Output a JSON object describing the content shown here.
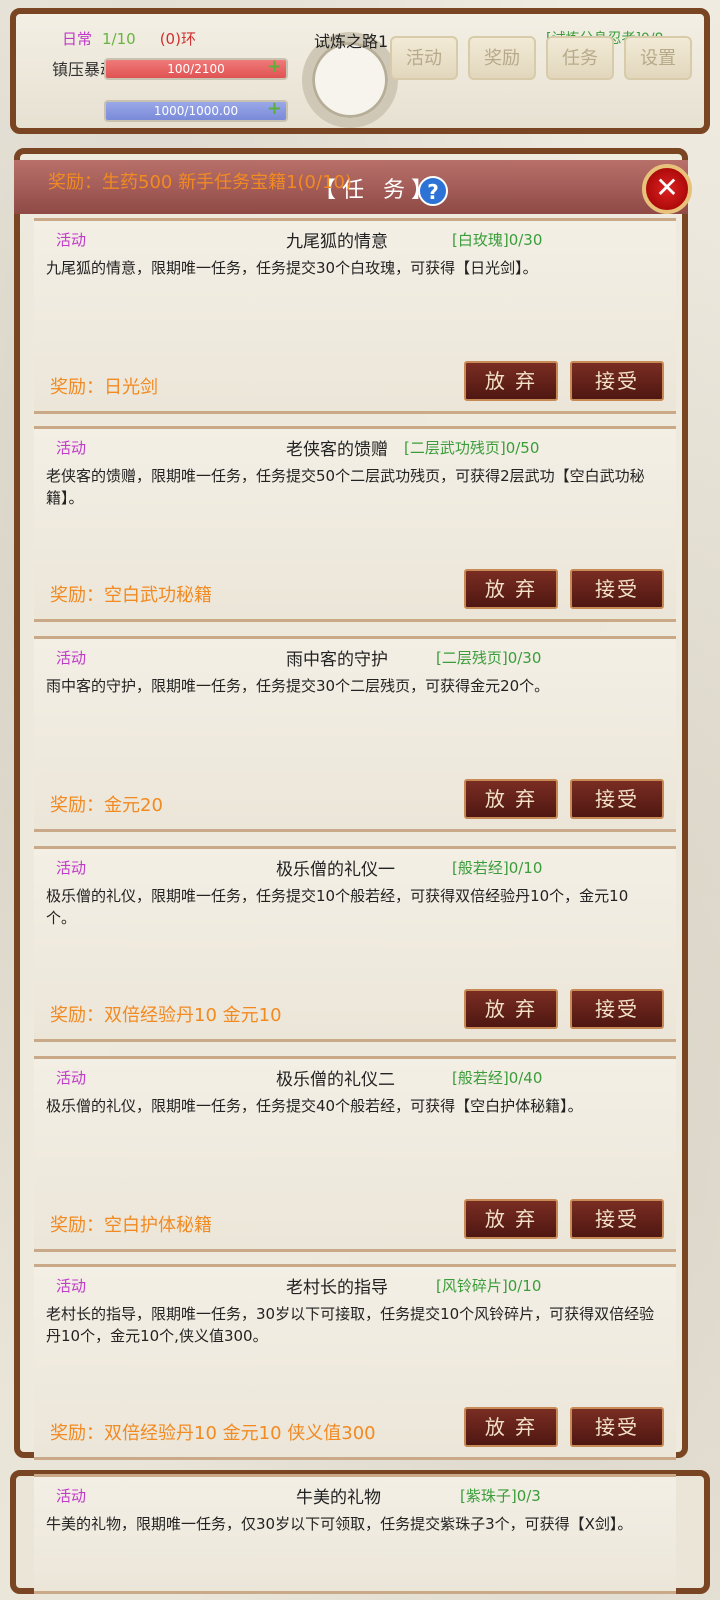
{
  "hud": {
    "daily_label": "日常",
    "daily_count": "1/10",
    "ring": "(0)环",
    "monster_task": "镇压暴动的怪物",
    "hp_text": "100/2100",
    "mp_text": "1000/1000.00",
    "trial_title": "试炼之路1",
    "clone_status": "[试炼分身忍者]0/8",
    "tabs": [
      "活动",
      "奖励",
      "任务",
      "设置"
    ]
  },
  "panel": {
    "title": "【任 务】",
    "help": "?",
    "close": "✕",
    "top_reward": "奖励：生药500 新手任务宝籍1(0/10)",
    "abandon_label": "放 弃",
    "accept_label": "接受"
  },
  "quests": [
    {
      "tag": "活动",
      "name": "九尾狐的情意",
      "req": "[白玫瑰]0/30",
      "desc": "九尾狐的情意，限期唯一任务，任务提交30个白玫瑰，可获得【日光剑】。",
      "reward": "奖励：日光剑"
    },
    {
      "tag": "活动",
      "name": "老侠客的馈赠",
      "req": "[二层武功残页]0/50",
      "desc": "老侠客的馈赠，限期唯一任务，任务提交50个二层武功残页，可获得2层武功【空白武功秘籍】。",
      "reward": "奖励：空白武功秘籍"
    },
    {
      "tag": "活动",
      "name": "雨中客的守护",
      "req": "[二层残页]0/30",
      "desc": "雨中客的守护，限期唯一任务，任务提交30个二层残页，可获得金元20个。",
      "reward": "奖励：金元20"
    },
    {
      "tag": "活动",
      "name": "极乐僧的礼仪一",
      "req": "[般若经]0/10",
      "desc": "极乐僧的礼仪，限期唯一任务，任务提交10个般若经，可获得双倍经验丹10个，金元10个。",
      "reward": "奖励：双倍经验丹10 金元10"
    },
    {
      "tag": "活动",
      "name": "极乐僧的礼仪二",
      "req": "[般若经]0/40",
      "desc": "极乐僧的礼仪，限期唯一任务，任务提交40个般若经，可获得【空白护体秘籍】。",
      "reward": "奖励：空白护体秘籍"
    },
    {
      "tag": "活动",
      "name": "老村长的指导",
      "req": "[风铃碎片]0/10",
      "desc": "老村长的指导，限期唯一任务，30岁以下可接取，任务提交10个风铃碎片，可获得双倍经验丹10个，金元10个,侠义值300。",
      "reward": "奖励：双倍经验丹10 金元10 侠义值300"
    },
    {
      "tag": "活动",
      "name": "牛美的礼物",
      "req": "[紫珠子]0/3",
      "desc": "牛美的礼物，限期唯一任务，仅30岁以下可领取，任务提交紫珠子3个，可获得【X剑】。",
      "reward": ""
    }
  ]
}
